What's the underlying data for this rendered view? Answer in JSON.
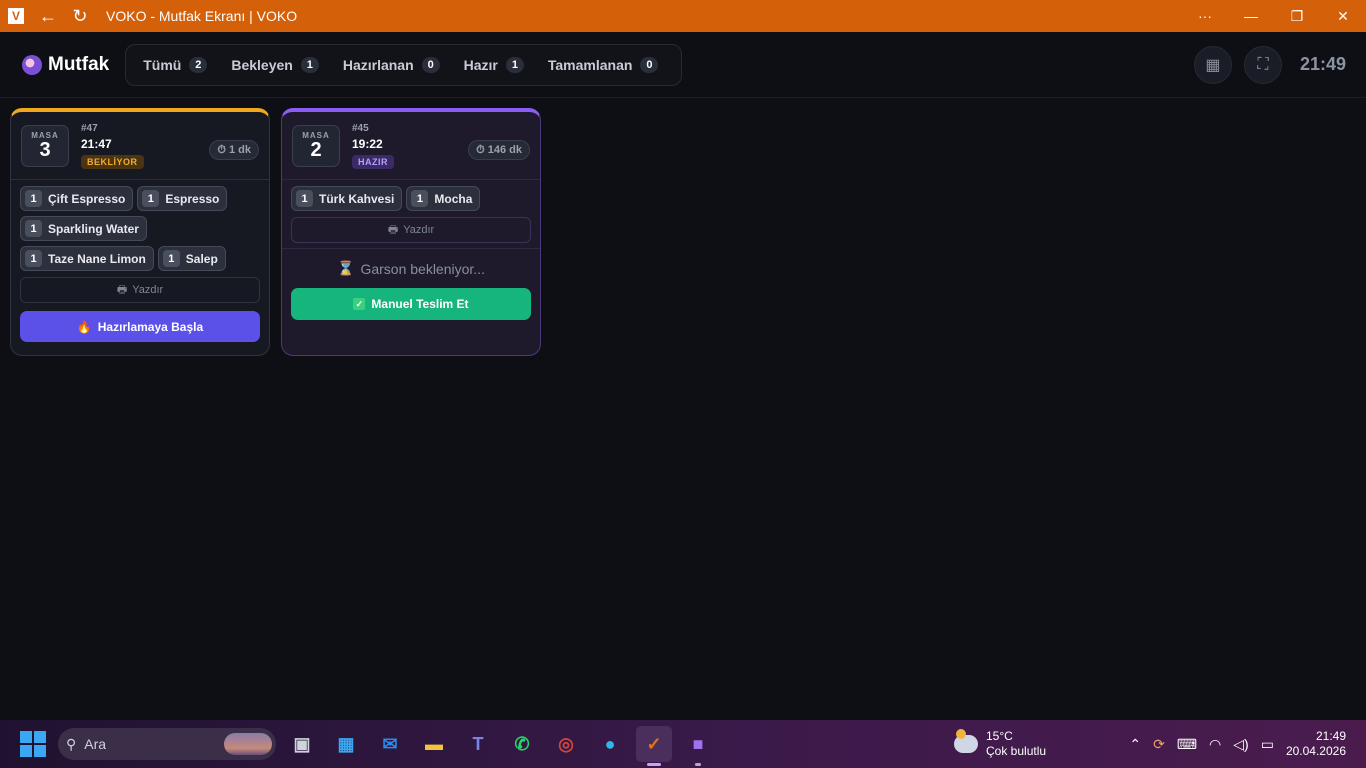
{
  "titlebar": {
    "title": "VOKO - Mutfak Ekranı | VOKO"
  },
  "header": {
    "brand": "Mutfak",
    "tabs": [
      {
        "label": "Tümü",
        "count": "2"
      },
      {
        "label": "Bekleyen",
        "count": "1"
      },
      {
        "label": "Hazırlanan",
        "count": "0"
      },
      {
        "label": "Hazır",
        "count": "1"
      },
      {
        "label": "Tamamlanan",
        "count": "0"
      }
    ],
    "clock": "21:49"
  },
  "orders": [
    {
      "masa_label": "MASA",
      "masa_number": "3",
      "order_number": "#47",
      "time": "21:47",
      "status": "BEKLİYOR",
      "duration": "1 dk",
      "items": [
        {
          "qty": "1",
          "name": "Çift Espresso"
        },
        {
          "qty": "1",
          "name": "Espresso"
        },
        {
          "qty": "1",
          "name": "Sparkling Water"
        },
        {
          "qty": "1",
          "name": "Taze Nane Limon"
        },
        {
          "qty": "1",
          "name": "Salep"
        }
      ],
      "print_label": "Yazdır",
      "action_label": "Hazırlamaya Başla"
    },
    {
      "masa_label": "MASA",
      "masa_number": "2",
      "order_number": "#45",
      "time": "19:22",
      "status": "HAZIR",
      "duration": "146 dk",
      "items": [
        {
          "qty": "1",
          "name": "Türk Kahvesi"
        },
        {
          "qty": "1",
          "name": "Mocha"
        }
      ],
      "print_label": "Yazdır",
      "waiting_text": "Garson bekleniyor...",
      "action_label": "Manuel Teslim Et"
    }
  ],
  "taskbar": {
    "search_placeholder": "Ara",
    "weather_temp": "15°C",
    "weather_desc": "Çok bulutlu",
    "time": "21:49",
    "date": "20.04.2026"
  },
  "colors": {
    "titlebar": "#d4600a",
    "status_wait": "#f0a81e",
    "status_ready": "#8b5cf6",
    "primary_button": "#5b50e8",
    "deliver_button": "#17b57e"
  }
}
